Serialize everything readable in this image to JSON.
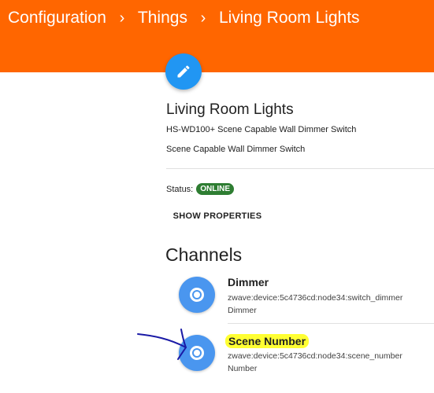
{
  "header": {
    "breadcrumbs": [
      "Configuration",
      "Things",
      "Living Room Lights"
    ],
    "separator": "›",
    "color": "#ff6600"
  },
  "edit_button": {
    "icon": "pencil-icon",
    "color": "#2196f3"
  },
  "thing": {
    "title": "Living Room Lights",
    "model": "HS-WD100+ Scene Capable Wall Dimmer Switch",
    "description": "Scene Capable Wall Dimmer Switch",
    "status_label": "Status:",
    "status": "ONLINE",
    "status_color": "#2e7d32",
    "show_properties_label": "SHOW PROPERTIES"
  },
  "channels": {
    "title": "Channels",
    "items": [
      {
        "label": "Dimmer",
        "uid": "zwave:device:5c4736cd:node34:switch_dimmer",
        "type": "Dimmer",
        "icon": "radio-button-icon",
        "highlighted": false
      },
      {
        "label": "Scene Number",
        "uid": "zwave:device:5c4736cd:node34:scene_number",
        "type": "Number",
        "icon": "radio-button-icon",
        "highlighted": true,
        "highlight_color": "#ffff33"
      }
    ]
  },
  "annotation": {
    "icon": "hand-drawn-arrow-icon",
    "color": "#1a1aa6"
  }
}
